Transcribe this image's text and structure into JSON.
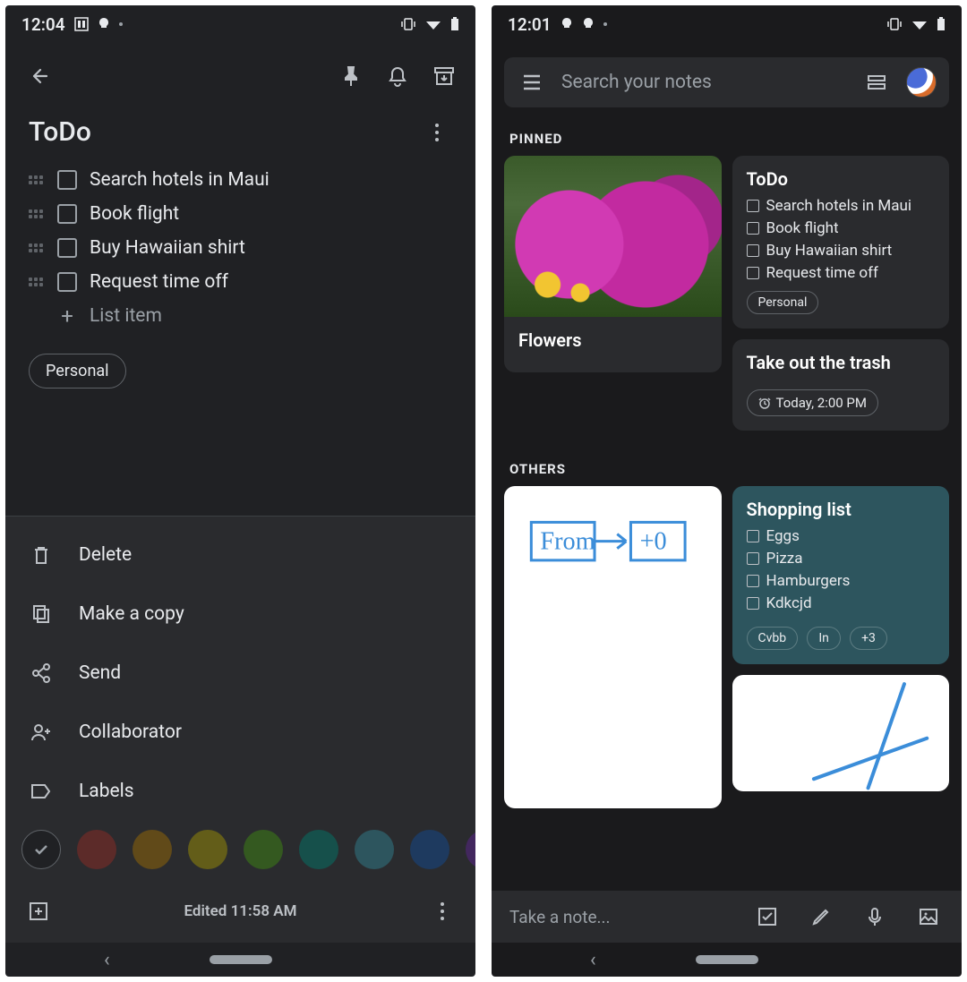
{
  "left": {
    "statusbar_time": "12:04",
    "note": {
      "title": "ToDo",
      "items": [
        "Search hotels in Maui",
        "Book flight",
        "Buy Hawaiian shirt",
        "Request time off"
      ],
      "add_placeholder": "List item",
      "label": "Personal"
    },
    "sheet": {
      "delete": "Delete",
      "copy": "Make a copy",
      "send": "Send",
      "collab": "Collaborator",
      "labels": "Labels"
    },
    "colors": [
      "#5c2b29",
      "#614a19",
      "#635d19",
      "#345920",
      "#16504b",
      "#2d555e",
      "#1e3a5f",
      "#42275e"
    ],
    "edited": "Edited 11:58 AM"
  },
  "right": {
    "statusbar_time": "12:01",
    "search_placeholder": "Search your notes",
    "sections": {
      "pinned": "PINNED",
      "others": "OTHERS"
    },
    "flowers_title": "Flowers",
    "todo": {
      "title": "ToDo",
      "items": [
        "Search hotels in Maui",
        "Book flight",
        "Buy Hawaiian shirt",
        "Request time off"
      ],
      "label": "Personal"
    },
    "trash": {
      "title": "Take out the trash",
      "reminder": "Today, 2:00 PM"
    },
    "drawing_text": {
      "from": "From",
      "to": "+0"
    },
    "shopping": {
      "title": "Shopping list",
      "items": [
        "Eggs",
        "Pizza",
        "Hamburgers",
        "Kdkcjd"
      ],
      "chips": [
        "Cvbb",
        "In",
        "+3"
      ]
    },
    "take_note": "Take a note..."
  }
}
